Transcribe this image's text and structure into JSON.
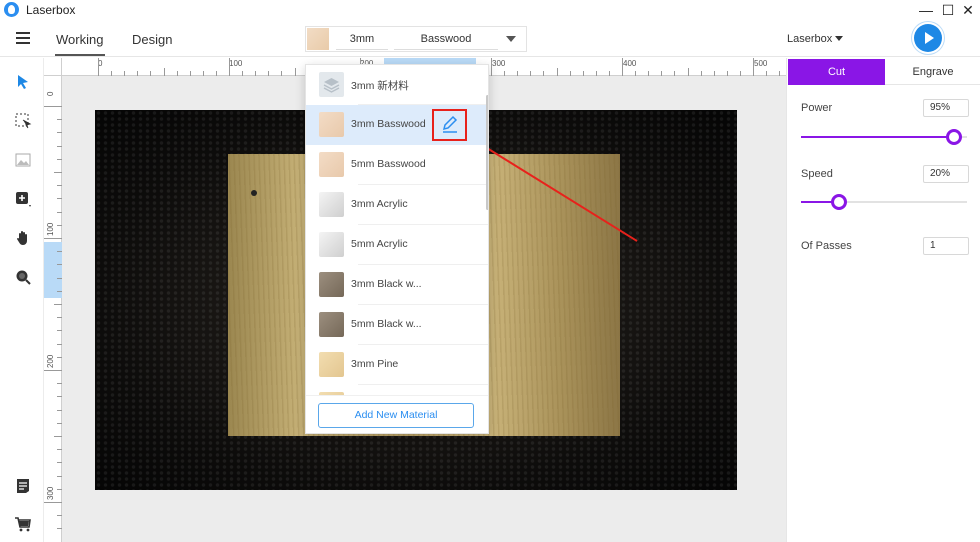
{
  "app": {
    "title": "Laserbox"
  },
  "window": {
    "minimize": "—",
    "maximize": "☐",
    "close": "✕"
  },
  "toolbar": {
    "tabs": [
      {
        "label": "Working",
        "active": true
      },
      {
        "label": "Design",
        "active": false
      }
    ],
    "material": {
      "thickness": "3mm",
      "name": "Basswood"
    },
    "device": "Laserbox"
  },
  "sidebar_tools": [
    "select-arrow-icon",
    "crop-select-icon",
    "image-icon",
    "add-shape-icon",
    "hand-pan-icon",
    "zoom-icon",
    "notes-icon",
    "cart-icon"
  ],
  "rulers": {
    "top_labels": [
      "0",
      "100",
      "200",
      "300",
      "400",
      "500"
    ],
    "left_labels": [
      "0",
      "100",
      "200",
      "300"
    ]
  },
  "dropdown": {
    "items": [
      {
        "label": "3mm 新材料",
        "swatch": "#e3e8ec",
        "selected": false
      },
      {
        "label": "3mm Basswood",
        "swatch": "#efd5bd",
        "selected": true
      },
      {
        "label": "5mm Basswood",
        "swatch": "#efd5bd",
        "selected": false
      },
      {
        "label": "3mm Acrylic",
        "swatch": "#e2e2e2",
        "selected": false
      },
      {
        "label": "5mm Acrylic",
        "swatch": "#e2e2e2",
        "selected": false
      },
      {
        "label": "3mm Black w...",
        "swatch": "#8a7c6c",
        "selected": false
      },
      {
        "label": "5mm Black w...",
        "swatch": "#8a7c6c",
        "selected": false
      },
      {
        "label": "3mm Pine",
        "swatch": "#ecd6a6",
        "selected": false
      }
    ],
    "add_button": "Add New Material"
  },
  "panel": {
    "tabs": {
      "cut": "Cut",
      "engrave": "Engrave"
    },
    "power": {
      "label": "Power",
      "value": "95%",
      "level": 0.92
    },
    "speed": {
      "label": "Speed",
      "value": "20%",
      "level": 0.23
    },
    "passes": {
      "label": "Of Passes",
      "value": "1"
    }
  },
  "colors": {
    "accent": "#8a16e6",
    "blue": "#2b8ef0",
    "highlight_red": "#e8211b"
  }
}
